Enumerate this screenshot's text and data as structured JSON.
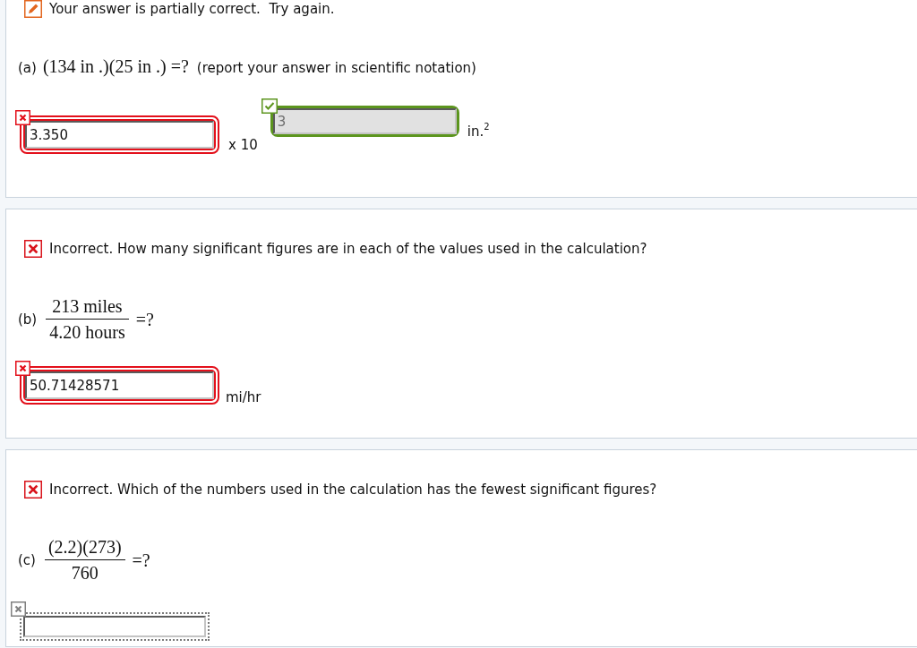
{
  "parts": [
    {
      "feedback": {
        "partially_correct": true,
        "text": "Your answer is partially correct.  Try again."
      },
      "question": {
        "label": "(a)",
        "kind": "inline",
        "expression": "(134 in .)(25 in .) =?",
        "note": "(report your answer in scientific notation)"
      },
      "answer": [
        {
          "kind": "field",
          "value": "3.350",
          "correct": false,
          "disabled": false
        },
        {
          "kind": "multiplier",
          "text": "x 10"
        },
        {
          "kind": "exponent",
          "value": "3",
          "correct": true,
          "disabled": true
        },
        {
          "kind": "unit",
          "text": "in.$^{2}$"
        }
      ]
    },
    {
      "feedback": {
        "partially_correct": false,
        "text": "Incorrect. How many significant figures are in each of the values used in the calculation?"
      },
      "question": {
        "label": "(b)",
        "kind": "fraction",
        "numerator": "213 miles",
        "denominator": "4.20 hours",
        "suffix": "=?"
      },
      "answer": [
        {
          "kind": "field",
          "value": "50.71428571",
          "correct": false,
          "disabled": false
        },
        {
          "kind": "unit",
          "text": "mi/hr"
        }
      ]
    },
    {
      "feedback": {
        "partially_correct": false,
        "text": "Incorrect. Which of the numbers used in the calculation has the fewest significant figures?"
      },
      "question": {
        "label": "(c)",
        "kind": "fraction",
        "numerator": "(2.2)(273)",
        "denominator": "760",
        "suffix": "=?"
      },
      "answer": [
        {
          "kind": "field",
          "correct": false,
          "disabled": false
        }
      ]
    }
  ]
}
